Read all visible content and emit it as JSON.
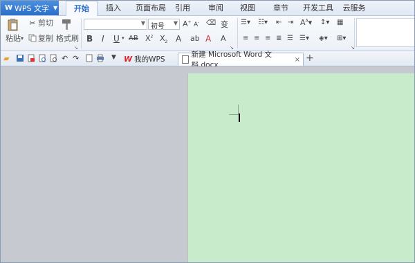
{
  "app": {
    "title": "WPS 文字",
    "logo": "W"
  },
  "tabs": [
    {
      "label": "开始",
      "active": true
    },
    {
      "label": "插入"
    },
    {
      "label": "页面布局"
    },
    {
      "label": "引用"
    },
    {
      "label": "审阅"
    },
    {
      "label": "视图"
    },
    {
      "label": "章节"
    },
    {
      "label": "开发工具"
    },
    {
      "label": "云服务"
    }
  ],
  "clipboard": {
    "paste": "粘贴",
    "cut": "剪切",
    "copy": "复制",
    "format_painter": "格式刷"
  },
  "font": {
    "name_value": "",
    "size_value": "初号"
  },
  "doc_tabs": {
    "mywps": "我的WPS",
    "current": "新建 Microsoft Word 文档.docx",
    "close": "×",
    "add": "+"
  },
  "colors": {
    "accent": "#2b6fc8",
    "page_bg": "#c8ebcb",
    "workspace": "#c6c9d0"
  }
}
